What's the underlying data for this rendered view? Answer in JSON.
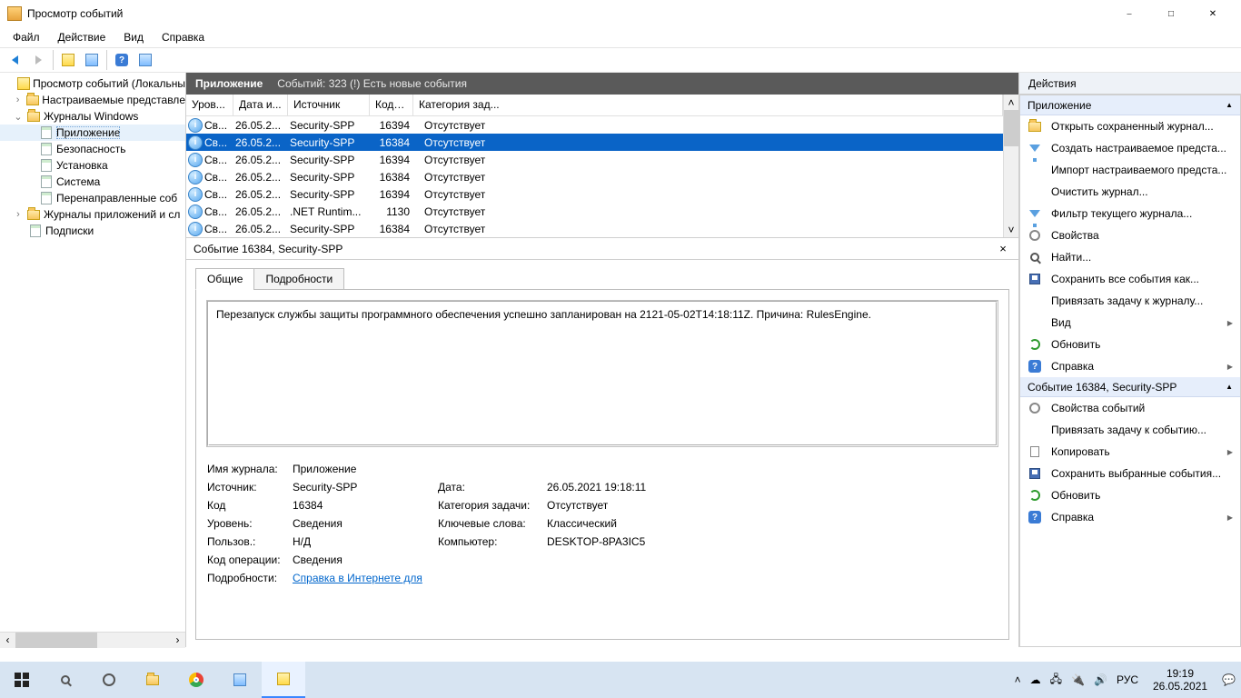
{
  "window": {
    "title": "Просмотр событий"
  },
  "menu": {
    "file": "Файл",
    "action": "Действие",
    "view": "Вид",
    "help": "Справка"
  },
  "tree": {
    "root": "Просмотр событий (Локальны",
    "custom_views": "Настраиваемые представле",
    "win_logs": "Журналы Windows",
    "app": "Приложение",
    "security": "Безопасность",
    "setup": "Установка",
    "system": "Система",
    "forwarded": "Перенаправленные соб",
    "app_services": "Журналы приложений и сл",
    "subscriptions": "Подписки"
  },
  "center_header": {
    "title": "Приложение",
    "summary": "Событий: 323 (!) Есть новые события"
  },
  "cols": {
    "level": "Уров...",
    "date": "Дата и...",
    "source": "Источник",
    "code": "Код с...",
    "category": "Категория зад..."
  },
  "events": [
    {
      "level": "Св...",
      "date": "26.05.2...",
      "source": "Security-SPP",
      "code": "16394",
      "cat": "Отсутствует"
    },
    {
      "level": "Св...",
      "date": "26.05.2...",
      "source": "Security-SPP",
      "code": "16384",
      "cat": "Отсутствует"
    },
    {
      "level": "Св...",
      "date": "26.05.2...",
      "source": "Security-SPP",
      "code": "16394",
      "cat": "Отсутствует"
    },
    {
      "level": "Св...",
      "date": "26.05.2...",
      "source": "Security-SPP",
      "code": "16384",
      "cat": "Отсутствует"
    },
    {
      "level": "Св...",
      "date": "26.05.2...",
      "source": "Security-SPP",
      "code": "16394",
      "cat": "Отсутствует"
    },
    {
      "level": "Св...",
      "date": "26.05.2...",
      "source": ".NET Runtim...",
      "code": "1130",
      "cat": "Отсутствует"
    },
    {
      "level": "Св...",
      "date": "26.05.2...",
      "source": "Security-SPP",
      "code": "16384",
      "cat": "Отсутствует"
    }
  ],
  "selected_event_index": 1,
  "detail_header": "Событие 16384, Security-SPP",
  "tabs": {
    "general": "Общие",
    "details": "Подробности"
  },
  "description": "Перезапуск службы защиты программного обеспечения успешно запланирован на 2121-05-02T14:18:11Z. Причина: RulesEngine.",
  "props": {
    "log_name_k": "Имя журнала:",
    "log_name_v": "Приложение",
    "source_k": "Источник:",
    "source_v": "Security-SPP",
    "date_k": "Дата:",
    "date_v": "26.05.2021 19:18:11",
    "code_k": "Код",
    "code_v": "16384",
    "task_cat_k": "Категория задачи:",
    "task_cat_v": "Отсутствует",
    "level_k": "Уровень:",
    "level_v": "Сведения",
    "keywords_k": "Ключевые слова:",
    "keywords_v": "Классический",
    "user_k": "Пользов.:",
    "user_v": "Н/Д",
    "computer_k": "Компьютер:",
    "computer_v": "DESKTOP-8PA3IC5",
    "opcode_k": "Код операции:",
    "opcode_v": "Сведения",
    "more_k": "Подробности:",
    "more_link": "Справка в Интернете для "
  },
  "actions": {
    "title": "Действия",
    "section_app": "Приложение",
    "open_saved": "Открыть сохраненный журнал...",
    "create_custom": "Создать настраиваемое предста...",
    "import_custom": "Импорт настраиваемого предста...",
    "clear_log": "Очистить журнал...",
    "filter_log": "Фильтр текущего журнала...",
    "properties": "Свойства",
    "find": "Найти...",
    "save_all": "Сохранить все события как...",
    "attach_task_log": "Привязать задачу к журналу...",
    "view": "Вид",
    "refresh": "Обновить",
    "help": "Справка",
    "section_event": "Событие 16384, Security-SPP",
    "event_props": "Свойства событий",
    "attach_task_event": "Привязать задачу к событию...",
    "copy": "Копировать",
    "save_selected": "Сохранить выбранные события...",
    "refresh2": "Обновить",
    "help2": "Справка"
  },
  "taskbar": {
    "lang": "РУС",
    "time": "19:19",
    "date": "26.05.2021"
  }
}
